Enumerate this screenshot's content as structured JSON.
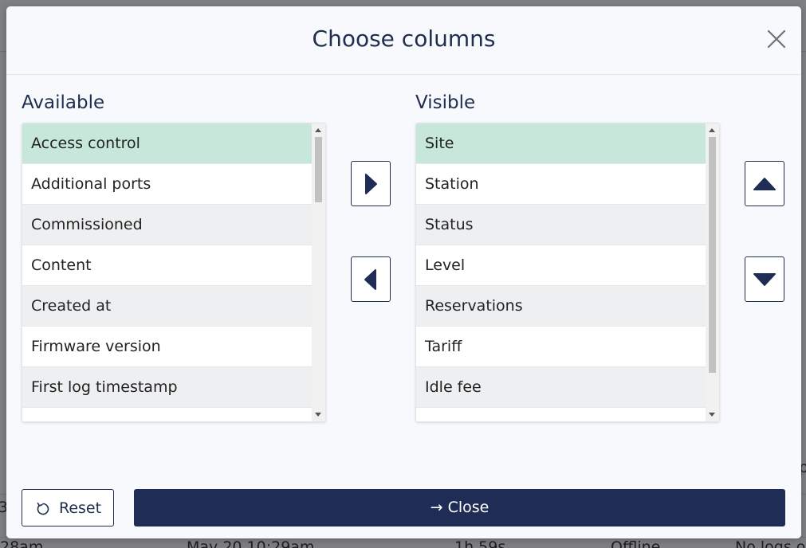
{
  "modal": {
    "title": "Choose columns",
    "available_label": "Available",
    "visible_label": "Visible",
    "reset_label": "Reset",
    "close_label": "Close",
    "close_arrow": "→"
  },
  "available_items": [
    "Access control",
    "Additional ports",
    "Commissioned",
    "Content",
    "Created at",
    "Firmware version",
    "First log timestamp"
  ],
  "visible_items": [
    "Site",
    "Station",
    "Status",
    "Level",
    "Reservations",
    "Tariff",
    "Idle fee"
  ],
  "background": {
    "row1_cells": [
      "3",
      "p"
    ],
    "row2_cells": [
      "28am",
      "May 20 10:29am",
      "1h 59s",
      "Offline",
      "No logs o"
    ]
  },
  "colors": {
    "accent": "#1f2d56",
    "selected_row": "#c7e7db"
  }
}
